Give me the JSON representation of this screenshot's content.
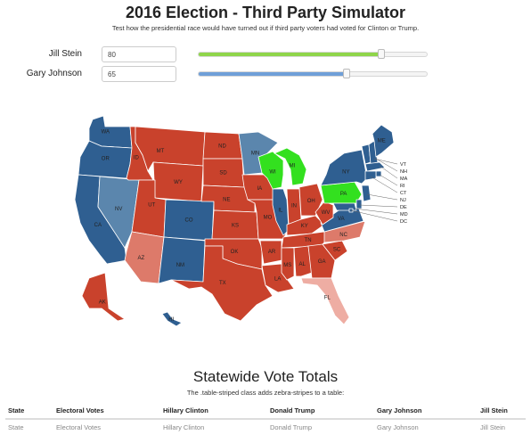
{
  "header": {
    "title": "2016 Election - Third Party Simulator",
    "subtitle": "Test how the presidential race would have turned out if third party voters had voted for Clinton or Trump."
  },
  "controls": [
    {
      "label": "Jill Stein",
      "value": "80",
      "percent": 80,
      "fill_color": "#8fd54a"
    },
    {
      "label": "Gary Johnson",
      "value": "65",
      "percent": 65,
      "fill_color": "#6f9fd8"
    }
  ],
  "colors": {
    "dem": "#2f5f91",
    "dem_light": "#5b86ad",
    "rep": "#c9422c",
    "rep_light": "#dd7a6a",
    "rep_pale": "#eeada3",
    "flip": "#33e01f"
  },
  "map": {
    "states": [
      {
        "abbr": "WA",
        "color": "dem"
      },
      {
        "abbr": "OR",
        "color": "dem"
      },
      {
        "abbr": "CA",
        "color": "dem"
      },
      {
        "abbr": "NV",
        "color": "dem_light"
      },
      {
        "abbr": "ID",
        "color": "rep"
      },
      {
        "abbr": "MT",
        "color": "rep"
      },
      {
        "abbr": "WY",
        "color": "rep"
      },
      {
        "abbr": "UT",
        "color": "rep"
      },
      {
        "abbr": "AZ",
        "color": "rep_light"
      },
      {
        "abbr": "CO",
        "color": "dem"
      },
      {
        "abbr": "NM",
        "color": "dem"
      },
      {
        "abbr": "ND",
        "color": "rep"
      },
      {
        "abbr": "SD",
        "color": "rep"
      },
      {
        "abbr": "NE",
        "color": "rep"
      },
      {
        "abbr": "KS",
        "color": "rep"
      },
      {
        "abbr": "OK",
        "color": "rep"
      },
      {
        "abbr": "TX",
        "color": "rep"
      },
      {
        "abbr": "MN",
        "color": "dem_light"
      },
      {
        "abbr": "IA",
        "color": "rep"
      },
      {
        "abbr": "MO",
        "color": "rep"
      },
      {
        "abbr": "AR",
        "color": "rep"
      },
      {
        "abbr": "LA",
        "color": "rep"
      },
      {
        "abbr": "WI",
        "color": "flip"
      },
      {
        "abbr": "IL",
        "color": "dem"
      },
      {
        "abbr": "MI",
        "color": "flip"
      },
      {
        "abbr": "IN",
        "color": "rep"
      },
      {
        "abbr": "OH",
        "color": "rep"
      },
      {
        "abbr": "KY",
        "color": "rep"
      },
      {
        "abbr": "TN",
        "color": "rep"
      },
      {
        "abbr": "MS",
        "color": "rep"
      },
      {
        "abbr": "AL",
        "color": "rep"
      },
      {
        "abbr": "GA",
        "color": "rep"
      },
      {
        "abbr": "FL",
        "color": "rep_pale"
      },
      {
        "abbr": "SC",
        "color": "rep"
      },
      {
        "abbr": "NC",
        "color": "rep_light"
      },
      {
        "abbr": "VA",
        "color": "dem"
      },
      {
        "abbr": "WV",
        "color": "rep"
      },
      {
        "abbr": "PA",
        "color": "flip"
      },
      {
        "abbr": "NY",
        "color": "dem"
      },
      {
        "abbr": "ME",
        "color": "dem"
      },
      {
        "abbr": "AK",
        "color": "rep"
      },
      {
        "abbr": "HI",
        "color": "dem"
      }
    ],
    "small_states": [
      "VT",
      "NH",
      "MA",
      "RI",
      "CT",
      "NJ",
      "DE",
      "MD",
      "DC"
    ]
  },
  "results": {
    "title": "Statewide Vote Totals",
    "subtitle": "The .table-striped class adds zebra-stripes to a table:",
    "columns": [
      "State",
      "Electoral Votes",
      "Hillary Clinton",
      "Donald Trump",
      "Gary Johnson",
      "Jill Stein"
    ],
    "first_row": [
      "State",
      "Electoral Votes",
      "Hillary Clinton",
      "Donald Trump",
      "Gary Johnson",
      "Jill Stein"
    ]
  }
}
